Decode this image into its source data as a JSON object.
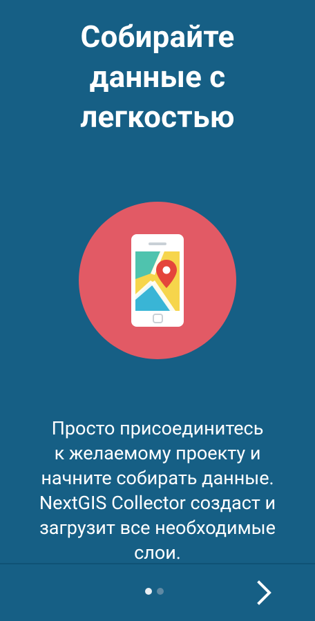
{
  "intro": {
    "title_lines": [
      "Собирайте",
      "данные с",
      "легкостью"
    ],
    "illustration_icon": "phone-map-pin-icon",
    "description_lines": [
      "Просто присоединитесь",
      "к желаемому проекту и",
      "начните собирать данные.",
      "NextGIS Collector создаст и",
      "загрузит все необходимые",
      "слои."
    ]
  },
  "pager": {
    "page_count": 2,
    "current_page": 1,
    "next_icon": "chevron-right-icon"
  },
  "colors": {
    "background": "#165f85",
    "circle": "#e25a65",
    "phone": "#ffffff",
    "map_yellow": "#f6d54b",
    "map_teal": "#4fc3ae",
    "map_blue": "#39b5d6",
    "pin_red": "#e4453b",
    "dot_active": "#e8eef3",
    "dot_inactive": "#5f89a3"
  }
}
